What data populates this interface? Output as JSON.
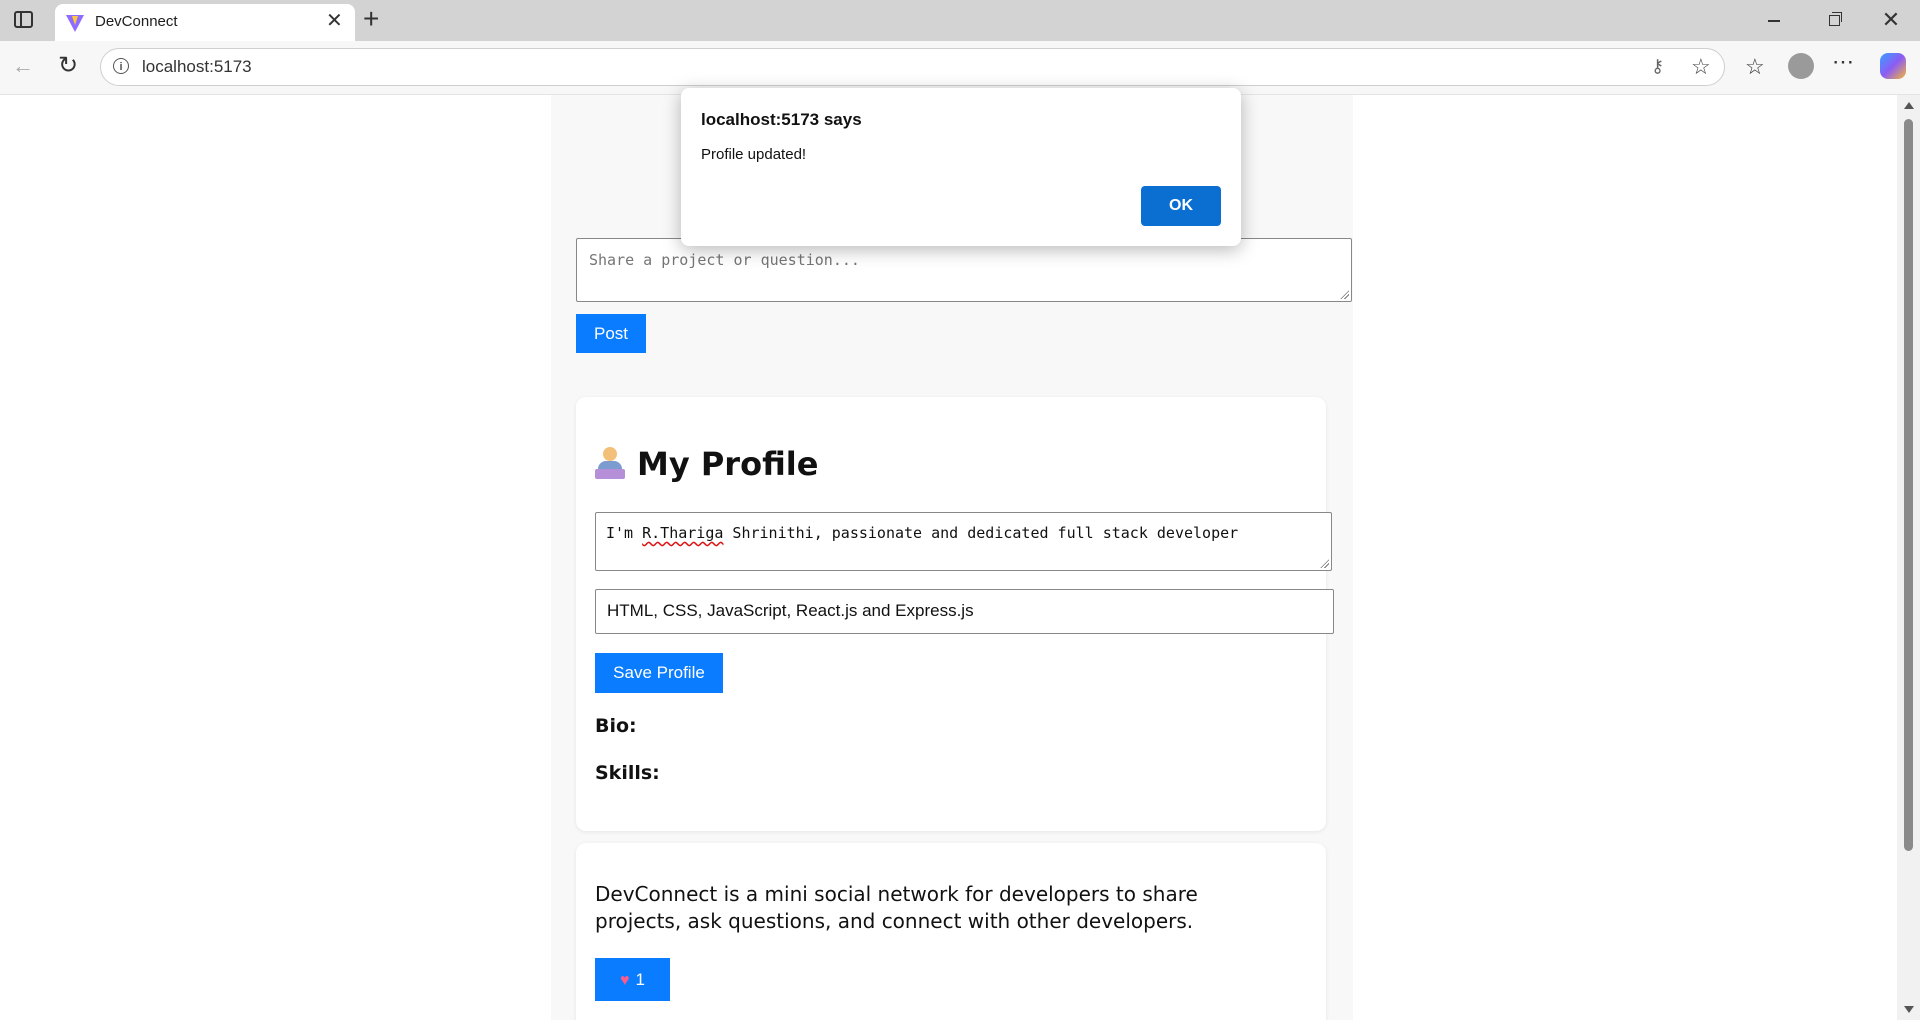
{
  "browser": {
    "tab_title": "DevConnect",
    "url": "localhost:5173"
  },
  "page": {
    "post_placeholder": "Share a project or question...",
    "post_button": "Post",
    "profile": {
      "heading": "My Profile",
      "bio_value_prefix": "I'm ",
      "bio_value_misspelled": "R.Thariga",
      "bio_value_rest": " Shrinithi, passionate and dedicated full stack developer",
      "skills_value": "HTML, CSS, JavaScript, React.js and Express.js",
      "save_button": "Save Profile",
      "bio_label": "Bio:",
      "skills_label": "Skills:"
    },
    "post": {
      "text": "DevConnect is a mini social network for developers to share projects, ask questions, and connect with other developers.",
      "like_count": "1"
    }
  },
  "dialog": {
    "title": "localhost:5173 says",
    "message": "Profile updated!",
    "ok_label": "OK"
  },
  "colors": {
    "primary_button": "#0a7cff",
    "dialog_ok": "#0b6fd2"
  }
}
